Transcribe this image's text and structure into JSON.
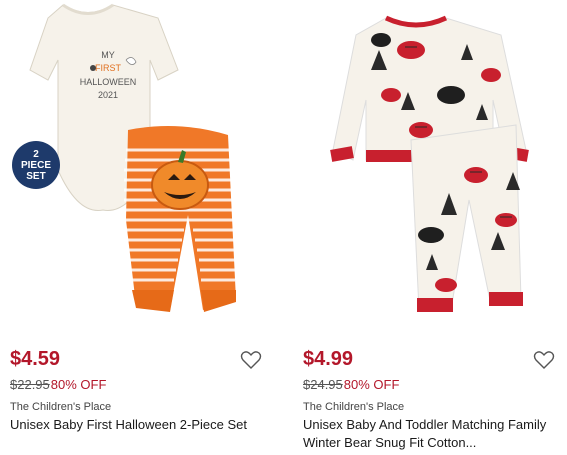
{
  "products": [
    {
      "badge_lines": [
        "2",
        "PIECE",
        "SET"
      ],
      "shirt_text": [
        "MY",
        "FIRST",
        "HALLOWEEN",
        "2021"
      ],
      "price": "$4.59",
      "original_price": "$22.95",
      "discount": "80% OFF",
      "brand": "The Children's Place",
      "name": "Unisex Baby First Halloween 2-Piece Set"
    },
    {
      "price": "$4.99",
      "original_price": "$24.95",
      "discount": "80% OFF",
      "brand": "The Children's Place",
      "name": "Unisex Baby And Toddler Matching Family Winter Bear Snug Fit Cotton..."
    }
  ],
  "colors": {
    "price_red": "#b3172a",
    "badge_navy": "#1e3a6b",
    "pajama_red": "#c8202e"
  },
  "icons": [
    "heart-icon",
    "heart-icon"
  ]
}
